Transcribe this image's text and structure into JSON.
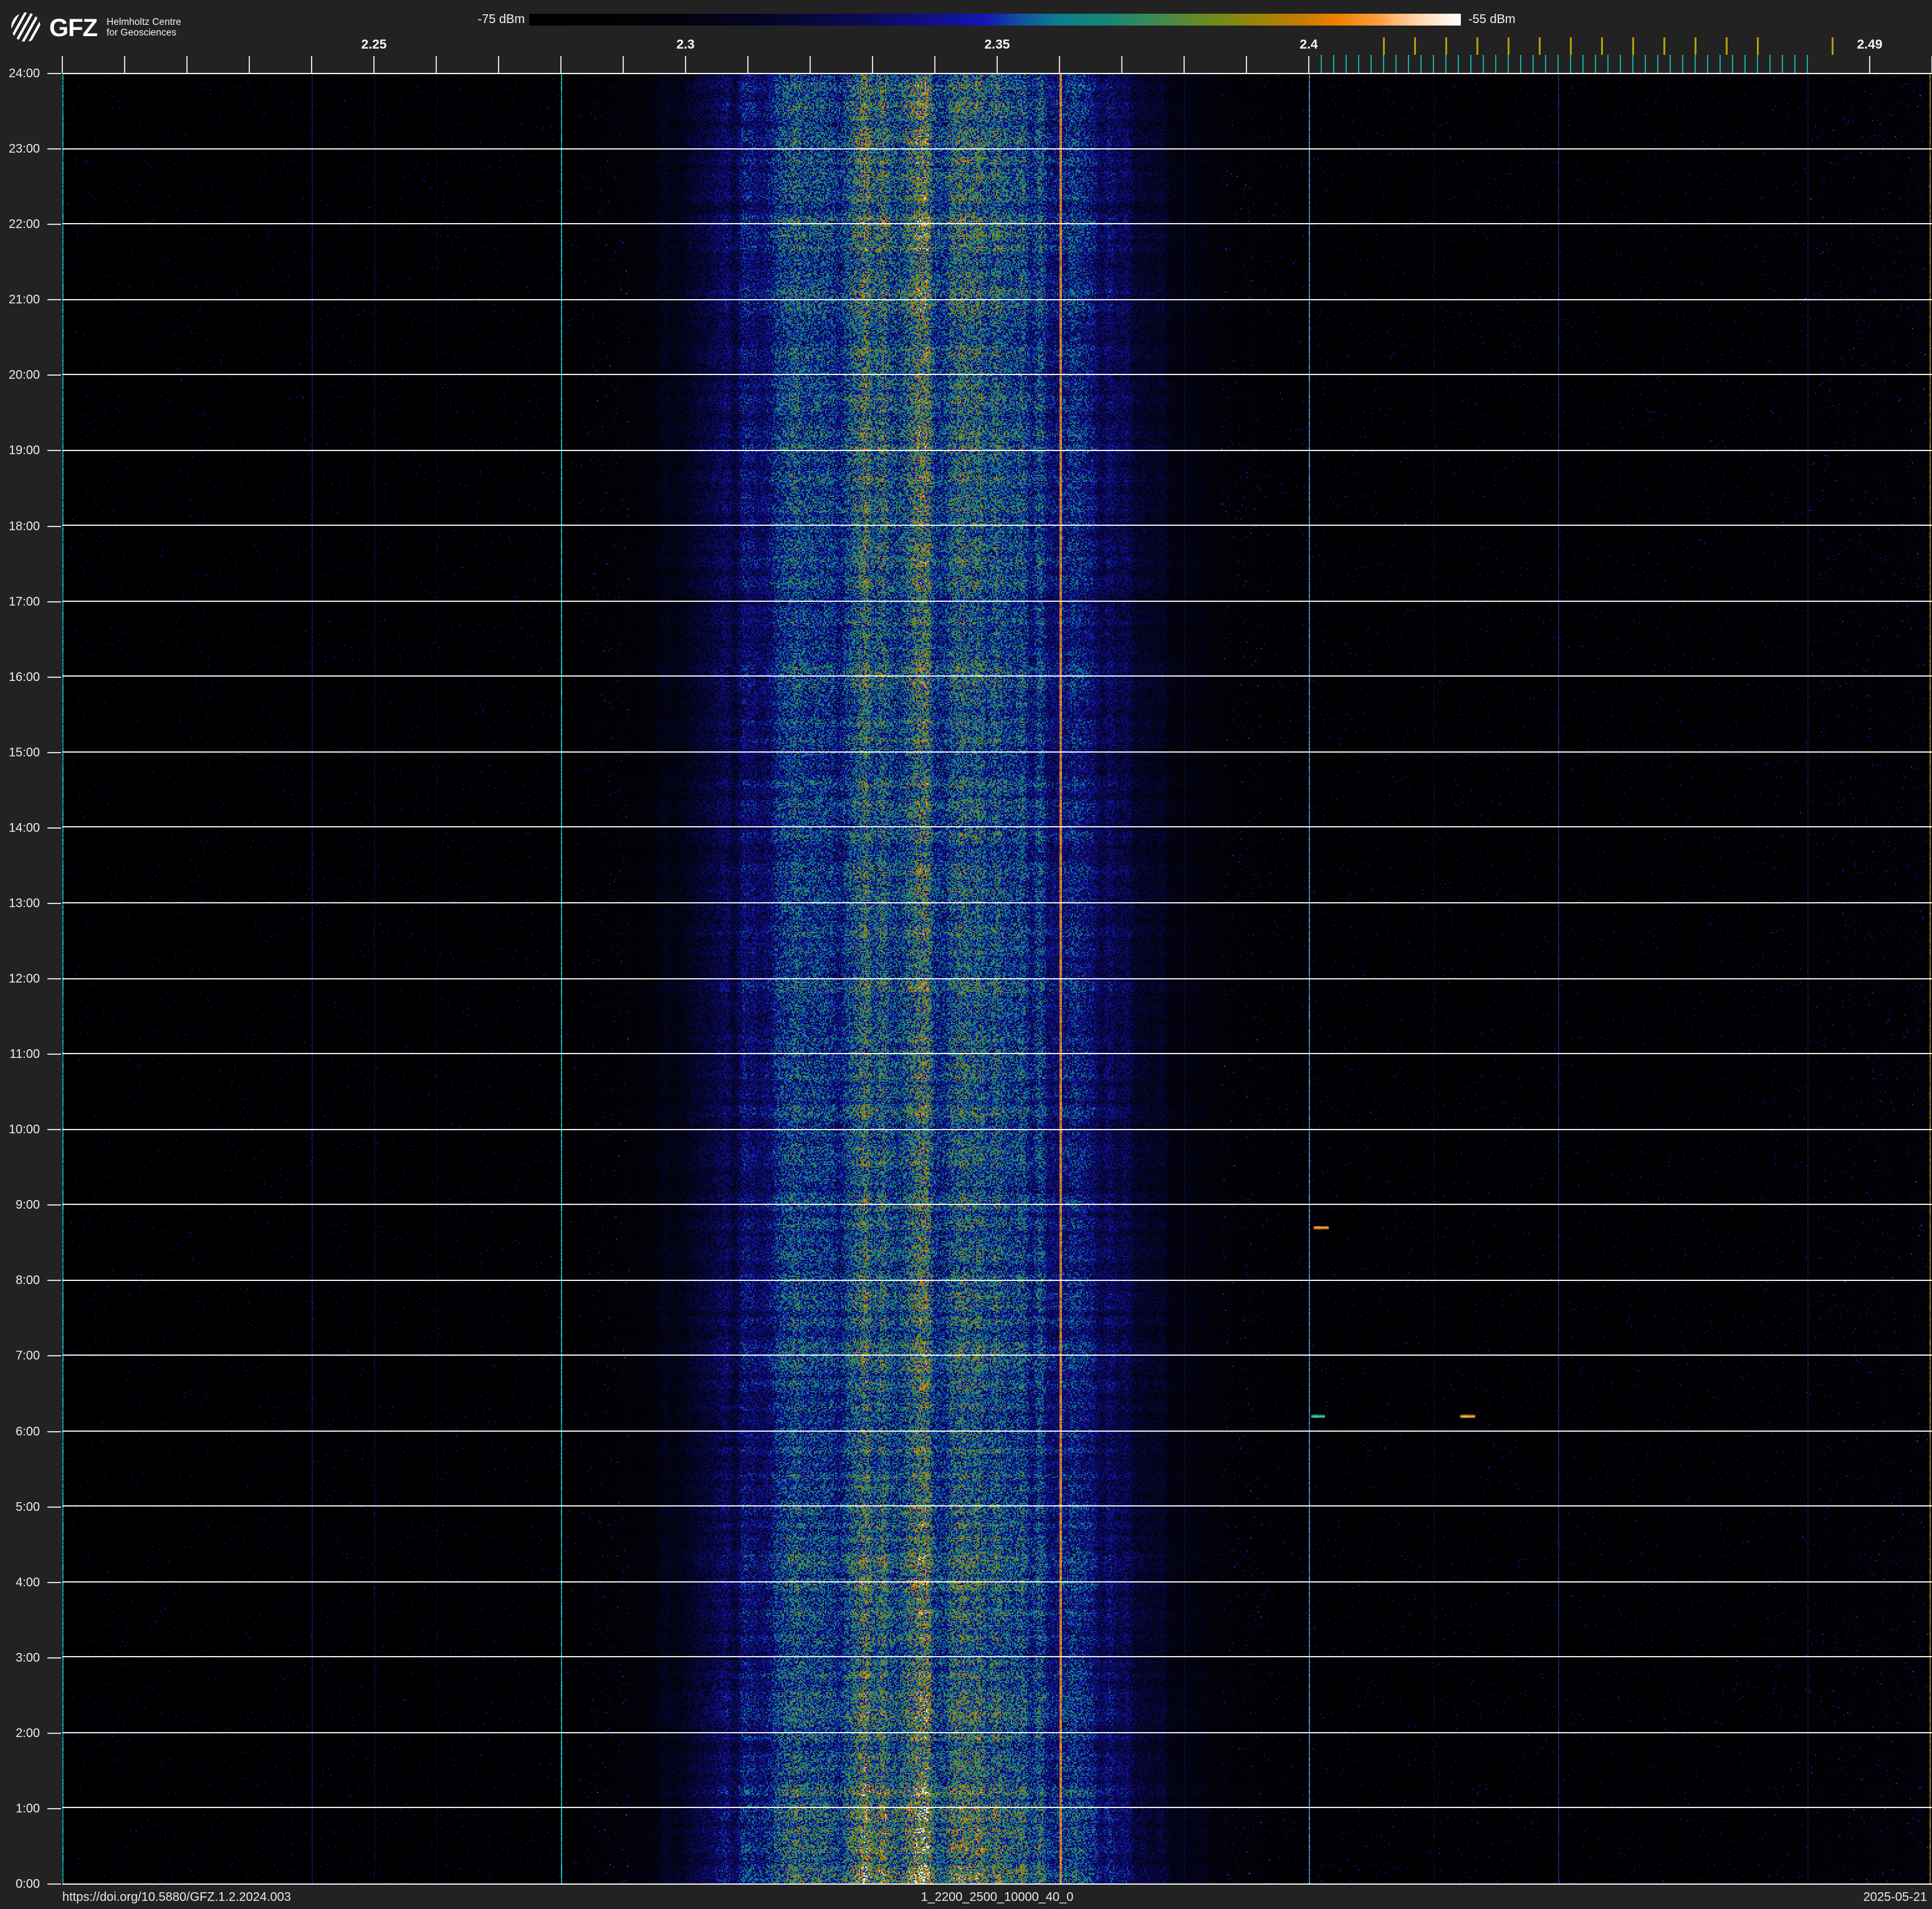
{
  "header": {
    "logo": {
      "brand": "GFZ",
      "line1": "Helmholtz Centre",
      "line2": "for Geosciences"
    },
    "colorbar": {
      "min_label": "-75 dBm",
      "max_label": "-55 dBm"
    }
  },
  "footer": {
    "doi": "https://doi.org/10.5880/GFZ.1.2.2024.003",
    "dataset": "1_2200_2500_10000_40_0",
    "date": "2025-05-21"
  },
  "colors": {
    "page_bg": "#222222",
    "plot_bg": "#000000",
    "axis_line": "#f2f2f2",
    "major_tick": "#d9d9d9",
    "gridline": "rgba(255,255,255,0.92)",
    "ble_tick": "#17aaa2",
    "wifi_tick": "#b2a104"
  },
  "chart_data": {
    "type": "heatmap",
    "description": "24-hour radio spectrogram (waterfall) of 2200-2500 MHz band, power in dBm mapped to colour",
    "x_axis": {
      "unit": "GHz",
      "min_mhz": 2200,
      "max_mhz": 2500,
      "major_tick_step_mhz": 10,
      "major_tick_range_mhz": [
        2200,
        2400
      ],
      "extra_major_ticks_mhz": [
        2490,
        2500
      ],
      "labels": [
        {
          "text": "2.25",
          "mhz": 2250
        },
        {
          "text": "2.3",
          "mhz": 2300
        },
        {
          "text": "2.35",
          "mhz": 2350
        },
        {
          "text": "2.4",
          "mhz": 2400
        },
        {
          "text": "2.49",
          "mhz": 2490
        }
      ]
    },
    "y_axis": {
      "unit": "time of day",
      "top_to_bottom": true,
      "hour_step": 1,
      "labels": [
        {
          "text": "24:00",
          "hour": 24
        },
        {
          "text": "23:00",
          "hour": 23
        },
        {
          "text": "22:00",
          "hour": 22
        },
        {
          "text": "21:00",
          "hour": 21
        },
        {
          "text": "20:00",
          "hour": 20
        },
        {
          "text": "19:00",
          "hour": 19
        },
        {
          "text": "18:00",
          "hour": 18
        },
        {
          "text": "17:00",
          "hour": 17
        },
        {
          "text": "16:00",
          "hour": 16
        },
        {
          "text": "15:00",
          "hour": 15
        },
        {
          "text": "14:00",
          "hour": 14
        },
        {
          "text": "13:00",
          "hour": 13
        },
        {
          "text": "12:00",
          "hour": 12
        },
        {
          "text": "11:00",
          "hour": 11
        },
        {
          "text": "10:00",
          "hour": 10
        },
        {
          "text": "9:00",
          "hour": 9
        },
        {
          "text": "8:00",
          "hour": 8
        },
        {
          "text": "7:00",
          "hour": 7
        },
        {
          "text": "6:00",
          "hour": 6
        },
        {
          "text": "5:00",
          "hour": 5
        },
        {
          "text": "4:00",
          "hour": 4
        },
        {
          "text": "3:00",
          "hour": 3
        },
        {
          "text": "2:00",
          "hour": 2
        },
        {
          "text": "1:00",
          "hour": 1
        },
        {
          "text": "0:00",
          "hour": 0
        }
      ]
    },
    "colorbar": {
      "min_dbm": -75,
      "max_dbm": -55,
      "stops": [
        [
          0.0,
          "#000000"
        ],
        [
          0.14,
          "#020208"
        ],
        [
          0.26,
          "#05052a"
        ],
        [
          0.36,
          "#0a0a58"
        ],
        [
          0.44,
          "#10108e"
        ],
        [
          0.49,
          "#1417b4"
        ],
        [
          0.53,
          "#0f55a0"
        ],
        [
          0.57,
          "#0d7f8b"
        ],
        [
          0.62,
          "#168578"
        ],
        [
          0.67,
          "#3c8a52"
        ],
        [
          0.73,
          "#6c8a20"
        ],
        [
          0.78,
          "#998605"
        ],
        [
          0.83,
          "#c47d00"
        ],
        [
          0.87,
          "#f08000"
        ],
        [
          0.91,
          "#ff9d3d"
        ],
        [
          0.95,
          "#ffd2a6"
        ],
        [
          1.0,
          "#ffffff"
        ]
      ]
    },
    "wifi_channel_ticks_mhz": [
      2412,
      2417,
      2422,
      2427,
      2432,
      2437,
      2442,
      2447,
      2452,
      2457,
      2462,
      2467,
      2472,
      2484
    ],
    "ble_channel_ticks_mhz": [
      2402,
      2404,
      2406,
      2408,
      2410,
      2412,
      2414,
      2416,
      2418,
      2420,
      2422,
      2424,
      2426,
      2428,
      2430,
      2432,
      2434,
      2436,
      2438,
      2440,
      2442,
      2444,
      2446,
      2448,
      2450,
      2452,
      2454,
      2456,
      2458,
      2460,
      2462,
      2464,
      2466,
      2468,
      2470,
      2472,
      2474,
      2476,
      2478,
      2480
    ],
    "power_profile": [
      [
        2200,
        0.03
      ],
      [
        2230,
        0.032
      ],
      [
        2240,
        0.05
      ],
      [
        2252,
        0.042
      ],
      [
        2268,
        0.048
      ],
      [
        2280,
        0.065
      ],
      [
        2290,
        0.11
      ],
      [
        2300,
        0.22
      ],
      [
        2308,
        0.33
      ],
      [
        2316,
        0.43
      ],
      [
        2324,
        0.5
      ],
      [
        2331,
        0.555
      ],
      [
        2338,
        0.56
      ],
      [
        2345,
        0.54
      ],
      [
        2352,
        0.5
      ],
      [
        2358,
        0.46
      ],
      [
        2364,
        0.4
      ],
      [
        2370,
        0.31
      ],
      [
        2376,
        0.22
      ],
      [
        2382,
        0.15
      ],
      [
        2388,
        0.105
      ],
      [
        2395,
        0.08
      ],
      [
        2405,
        0.068
      ],
      [
        2420,
        0.062
      ],
      [
        2440,
        0.06
      ],
      [
        2458,
        0.058
      ],
      [
        2470,
        0.062
      ],
      [
        2478,
        0.08
      ],
      [
        2488,
        0.095
      ],
      [
        2500,
        0.1
      ]
    ],
    "carriers": [
      {
        "mhz": 2200.2,
        "color": "#17b5b5",
        "width": 2,
        "alpha": 0.9
      },
      {
        "mhz": 2240,
        "color": "#2747ff",
        "width": 2,
        "alpha": 0.3
      },
      {
        "mhz": 2250,
        "color": "#2747ff",
        "width": 2,
        "alpha": 0.16
      },
      {
        "mhz": 2260,
        "color": "#2747ff",
        "width": 2,
        "alpha": 0.07
      },
      {
        "mhz": 2280,
        "color": "#15c9c4",
        "width": 2,
        "alpha": 0.92
      },
      {
        "mhz": 2334,
        "color": "#04281e",
        "width": 2,
        "alpha": 0.3
      },
      {
        "mhz": 2360,
        "color": "#e08a28",
        "width": 4,
        "alpha": 0.95
      },
      {
        "mhz": 2380,
        "color": "#2c52ff",
        "width": 2,
        "alpha": 0.12
      },
      {
        "mhz": 2400,
        "color": "#57a8dc",
        "width": 2,
        "alpha": 0.8
      },
      {
        "mhz": 2420,
        "color": "#2c52ff",
        "width": 2,
        "alpha": 0.1
      },
      {
        "mhz": 2440,
        "color": "#2e54e8",
        "width": 2,
        "alpha": 0.42
      },
      {
        "mhz": 2480,
        "color": "#2c50c8",
        "width": 2,
        "alpha": 0.22
      },
      {
        "mhz": 2499.7,
        "color": "#c8a820",
        "width": 2,
        "alpha": 0.7
      }
    ],
    "transients": [
      {
        "mhz": 2402.0,
        "hour": 8.7,
        "width_mhz": 2.4,
        "color": "#ffa133"
      },
      {
        "mhz": 2401.5,
        "hour": 6.2,
        "width_mhz": 2.2,
        "color": "#35d49a"
      },
      {
        "mhz": 2425.5,
        "hour": 6.2,
        "width_mhz": 2.4,
        "color": "#ffb43a"
      }
    ]
  }
}
